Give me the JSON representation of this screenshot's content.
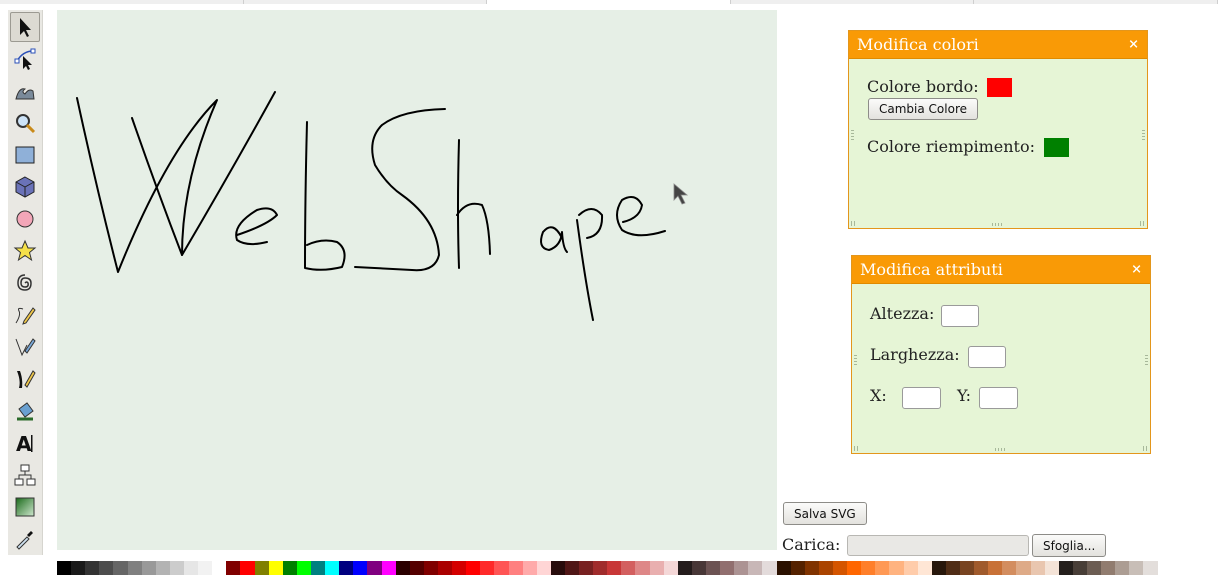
{
  "toolbar": {
    "tools": [
      {
        "name": "selector-tool",
        "icon": "arrow-pointer-icon",
        "active": true
      },
      {
        "name": "node-tool",
        "icon": "node-edit-icon"
      },
      {
        "name": "tweak-tool",
        "icon": "tweak-icon"
      },
      {
        "name": "zoom-tool",
        "icon": "magnifier-icon"
      },
      {
        "name": "rectangle-tool",
        "icon": "rectangle-icon"
      },
      {
        "name": "box3d-tool",
        "icon": "cube-icon"
      },
      {
        "name": "ellipse-tool",
        "icon": "circle-icon"
      },
      {
        "name": "star-tool",
        "icon": "star-icon"
      },
      {
        "name": "spiral-tool",
        "icon": "spiral-icon"
      },
      {
        "name": "pencil-tool",
        "icon": "pencil-icon"
      },
      {
        "name": "pen-tool",
        "icon": "pen-icon"
      },
      {
        "name": "calligraphy-tool",
        "icon": "calligraphy-icon"
      },
      {
        "name": "bucket-tool",
        "icon": "paint-bucket-icon"
      },
      {
        "name": "text-tool",
        "icon": "text-icon"
      },
      {
        "name": "connector-tool",
        "icon": "connector-icon"
      },
      {
        "name": "gradient-tool",
        "icon": "gradient-icon"
      },
      {
        "name": "dropper-tool",
        "icon": "dropper-icon"
      }
    ]
  },
  "colors_dialog": {
    "title": "Modifica colori",
    "close": "×",
    "stroke_label": "Colore bordo:",
    "stroke_color": "#ff0000",
    "change_button": "Cambia Colore",
    "fill_label": "Colore riempimento:",
    "fill_color": "#008000"
  },
  "attributes_dialog": {
    "title": "Modifica attributi",
    "close": "×",
    "height_label": "Altezza:",
    "width_label": "Larghezza:",
    "x_label": "X:",
    "y_label": "Y:",
    "height_value": "",
    "width_value": "",
    "x_value": "",
    "y_value": ""
  },
  "actions": {
    "save_svg": "Salva SVG",
    "load_label": "Carica:",
    "browse": "Sfoglia..."
  },
  "palette": [
    "#000000",
    "#1a1a1a",
    "#333333",
    "#4d4d4d",
    "#666666",
    "#808080",
    "#999999",
    "#b3b3b3",
    "#cccccc",
    "#e6e6e6",
    "#f2f2f2",
    "#ffffff",
    "#800000",
    "#ff0000",
    "#808000",
    "#ffff00",
    "#008000",
    "#00ff00",
    "#008080",
    "#00ffff",
    "#000080",
    "#0000ff",
    "#800080",
    "#ff00ff",
    "#2b0000",
    "#550000",
    "#800000",
    "#aa0000",
    "#d40000",
    "#ff0000",
    "#ff2a2a",
    "#ff5555",
    "#ff8080",
    "#ffaaaa",
    "#ffd5d5",
    "#280b0b",
    "#501616",
    "#782121",
    "#a02c2c",
    "#c83737",
    "#d35f5f",
    "#de8787",
    "#e9afaf",
    "#f4d7d7",
    "#241c1c",
    "#483737",
    "#6c5353",
    "#916f6f",
    "#ac9393",
    "#c8b7b7",
    "#e3dbdb",
    "#2b1100",
    "#552200",
    "#803300",
    "#aa4400",
    "#d45500",
    "#ff6600",
    "#ff7f2a",
    "#ff9955",
    "#ffb380",
    "#ffccaa",
    "#ffe6d5",
    "#28170b",
    "#502d16",
    "#784421",
    "#a05a2c",
    "#c87137",
    "#d38d5f",
    "#deaa87",
    "#e9c6af",
    "#f4e3d7",
    "#241f1c",
    "#483e37",
    "#6c5d53",
    "#917c6f",
    "#ac9d93",
    "#c8beb7",
    "#e3dedb"
  ]
}
